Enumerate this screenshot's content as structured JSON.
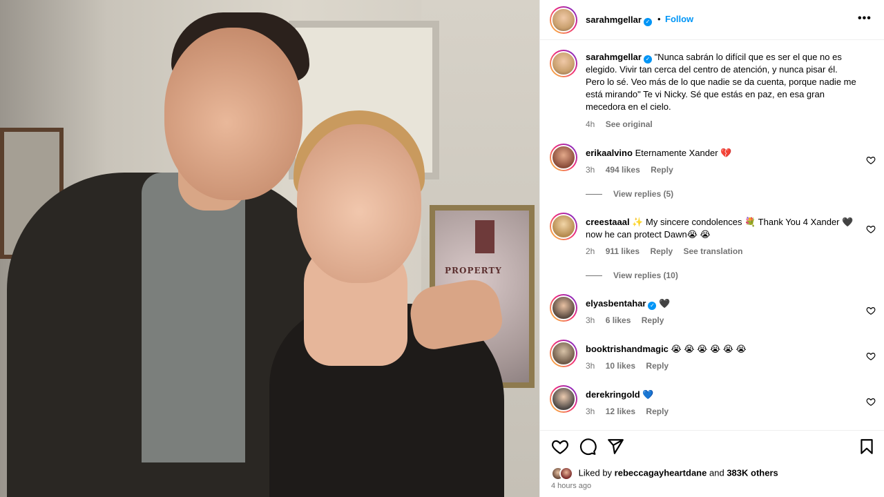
{
  "post": {
    "username": "sarahmgellar",
    "follow_label": "Follow",
    "dot": "•",
    "more_label": "•••",
    "caption": "\"Nunca sabrán lo difícil que es ser el que no es elegido. Vivir tan cerca del centro de atención, y nunca pisar él. Pero lo sé. Veo más de lo que nadie se da cuenta, porque nadie me está mirando\" Te vi Nicky. Sé que estás en paz, en esa gran mecedora en el cielo.",
    "caption_time": "4h",
    "see_original": "See original",
    "plaque_text": "PROPERTY"
  },
  "comments": [
    {
      "username": "erikaalvino",
      "text": "Eternamente Xander 💔",
      "time": "3h",
      "likes": "494 likes",
      "reply": "Reply",
      "view_replies": "View replies (5)",
      "verified": false
    },
    {
      "username": "creestaaal",
      "text": "✨ My sincere condolences 💐 Thank You 4 Xander 🖤 now he can protect Dawn😭 😭",
      "time": "2h",
      "likes": "911 likes",
      "reply": "Reply",
      "see_translation": "See translation",
      "view_replies": "View replies (10)",
      "verified": false
    },
    {
      "username": "elyasbentahar",
      "text": "🖤",
      "time": "3h",
      "likes": "6 likes",
      "reply": "Reply",
      "verified": true
    },
    {
      "username": "booktrishandmagic",
      "text": "😭 😭 😭 😭 😭 😭",
      "time": "3h",
      "likes": "10 likes",
      "reply": "Reply",
      "verified": false
    },
    {
      "username": "derekringold",
      "text": "💙",
      "time": "3h",
      "likes": "12 likes",
      "reply": "Reply",
      "verified": false
    }
  ],
  "footer": {
    "liked_by_prefix": "Liked by",
    "liked_by_user": "rebeccagayheartdane",
    "liked_and": "and",
    "liked_others": "383K others",
    "time": "4 hours ago"
  },
  "colors": {
    "accent": "#0095f6",
    "muted": "#737373",
    "border": "#efefef"
  },
  "icons": [
    "verified-badge-icon",
    "heart-icon",
    "comment-icon",
    "share-icon",
    "bookmark-icon",
    "more-icon"
  ]
}
